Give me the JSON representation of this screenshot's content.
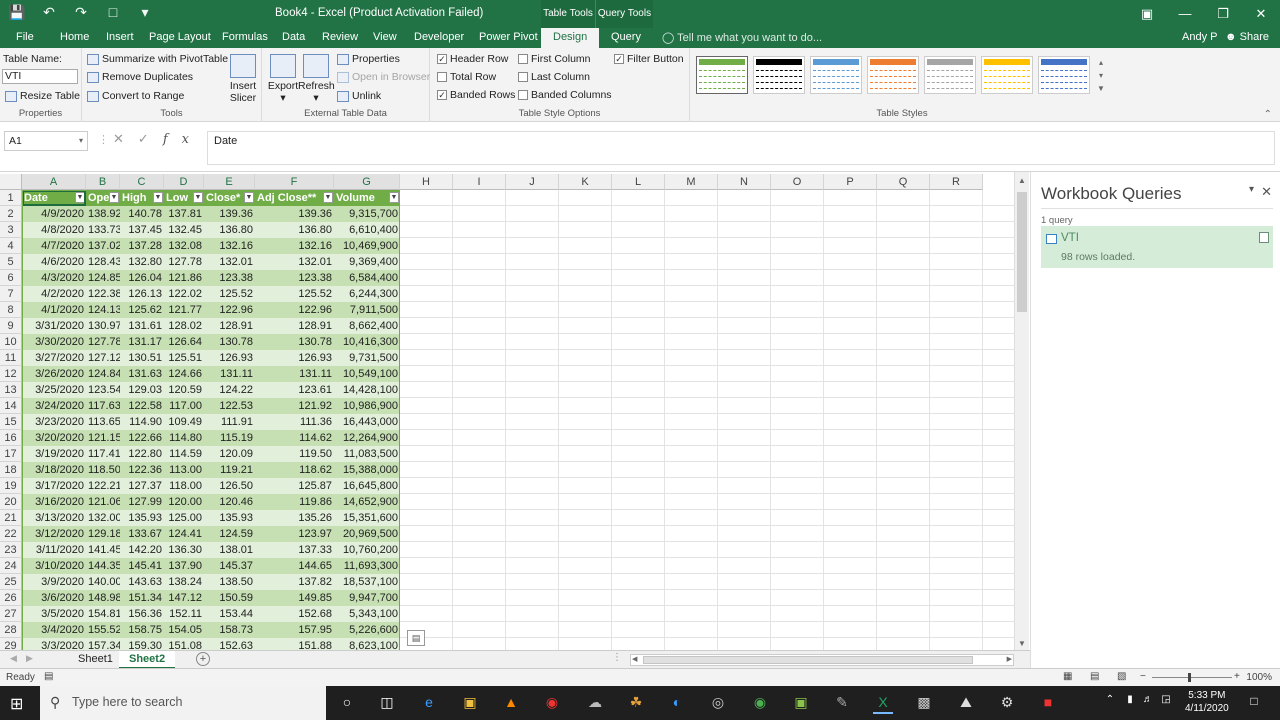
{
  "window": {
    "title": "Book4 - Excel (Product Activation Failed)",
    "context_tabs": [
      "Table Tools",
      "Query Tools"
    ]
  },
  "tabs": {
    "items": [
      "File",
      "Home",
      "Insert",
      "Page Layout",
      "Formulas",
      "Data",
      "Review",
      "View",
      "Developer",
      "Power Pivot",
      "Design",
      "Query"
    ],
    "active": "Design",
    "tell_me": "Tell me what you want to do...",
    "user": "Andy P",
    "share": "Share"
  },
  "ribbon": {
    "properties": {
      "label": "Properties",
      "table_name_label": "Table Name:",
      "table_name_value": "VTI",
      "resize": "Resize Table"
    },
    "tools": {
      "label": "Tools",
      "summarize": "Summarize with PivotTable",
      "remove_dup": "Remove Duplicates",
      "convert": "Convert to Range",
      "insert_slicer_1": "Insert",
      "insert_slicer_2": "Slicer"
    },
    "external": {
      "label": "External Table Data",
      "export": "Export",
      "refresh": "Refresh",
      "properties": "Properties",
      "open_browser": "Open in Browser",
      "unlink": "Unlink"
    },
    "style_options": {
      "label": "Table Style Options",
      "header_row": "Header Row",
      "total_row": "Total Row",
      "banded_rows": "Banded Rows",
      "first_column": "First Column",
      "last_column": "Last Column",
      "banded_columns": "Banded Columns",
      "filter_button": "Filter Button"
    },
    "table_styles": {
      "label": "Table Styles",
      "swatches": [
        "#70ad47",
        "#000000",
        "#5b9bd5",
        "#ed7d31",
        "#a5a5a5",
        "#ffc000",
        "#4472c4"
      ]
    }
  },
  "formula_bar": {
    "name_box": "A1",
    "content": "Date"
  },
  "grid": {
    "columns": [
      "A",
      "B",
      "C",
      "D",
      "E",
      "F",
      "G",
      "H",
      "I",
      "J",
      "K",
      "L",
      "M",
      "N",
      "O",
      "P",
      "Q",
      "R"
    ],
    "table_headers": [
      "Date",
      "Open",
      "High",
      "Low",
      "Close*",
      "Adj Close**",
      "Volume"
    ],
    "rows": [
      [
        "4/9/2020",
        "138.92",
        "140.78",
        "137.81",
        "139.36",
        "139.36",
        "9,315,700"
      ],
      [
        "4/8/2020",
        "133.73",
        "137.45",
        "132.45",
        "136.80",
        "136.80",
        "6,610,400"
      ],
      [
        "4/7/2020",
        "137.02",
        "137.28",
        "132.08",
        "132.16",
        "132.16",
        "10,469,900"
      ],
      [
        "4/6/2020",
        "128.43",
        "132.80",
        "127.78",
        "132.01",
        "132.01",
        "9,369,400"
      ],
      [
        "4/3/2020",
        "124.85",
        "126.04",
        "121.86",
        "123.38",
        "123.38",
        "6,584,400"
      ],
      [
        "4/2/2020",
        "122.38",
        "126.13",
        "122.02",
        "125.52",
        "125.52",
        "6,244,300"
      ],
      [
        "4/1/2020",
        "124.13",
        "125.62",
        "121.77",
        "122.96",
        "122.96",
        "7,911,500"
      ],
      [
        "3/31/2020",
        "130.97",
        "131.61",
        "128.02",
        "128.91",
        "128.91",
        "8,662,400"
      ],
      [
        "3/30/2020",
        "127.78",
        "131.17",
        "126.64",
        "130.78",
        "130.78",
        "10,416,300"
      ],
      [
        "3/27/2020",
        "127.12",
        "130.51",
        "125.51",
        "126.93",
        "126.93",
        "9,731,500"
      ],
      [
        "3/26/2020",
        "124.84",
        "131.63",
        "124.66",
        "131.11",
        "131.11",
        "10,549,100"
      ],
      [
        "3/25/2020",
        "123.54",
        "129.03",
        "120.59",
        "124.22",
        "123.61",
        "14,428,100"
      ],
      [
        "3/24/2020",
        "117.63",
        "122.58",
        "117.00",
        "122.53",
        "121.92",
        "10,986,900"
      ],
      [
        "3/23/2020",
        "113.65",
        "114.90",
        "109.49",
        "111.91",
        "111.36",
        "16,443,000"
      ],
      [
        "3/20/2020",
        "121.15",
        "122.66",
        "114.80",
        "115.19",
        "114.62",
        "12,264,900"
      ],
      [
        "3/19/2020",
        "117.41",
        "122.80",
        "114.59",
        "120.09",
        "119.50",
        "11,083,500"
      ],
      [
        "3/18/2020",
        "118.50",
        "122.36",
        "113.00",
        "119.21",
        "118.62",
        "15,388,000"
      ],
      [
        "3/17/2020",
        "122.21",
        "127.37",
        "118.00",
        "126.50",
        "125.87",
        "16,645,800"
      ],
      [
        "3/16/2020",
        "121.06",
        "127.99",
        "120.00",
        "120.46",
        "119.86",
        "14,652,900"
      ],
      [
        "3/13/2020",
        "132.00",
        "135.93",
        "125.00",
        "135.93",
        "135.26",
        "15,351,600"
      ],
      [
        "3/12/2020",
        "129.18",
        "133.67",
        "124.41",
        "124.59",
        "123.97",
        "20,969,500"
      ],
      [
        "3/11/2020",
        "141.45",
        "142.20",
        "136.30",
        "138.01",
        "137.33",
        "10,760,200"
      ],
      [
        "3/10/2020",
        "144.35",
        "145.41",
        "137.90",
        "145.37",
        "144.65",
        "11,693,300"
      ],
      [
        "3/9/2020",
        "140.00",
        "143.63",
        "138.24",
        "138.50",
        "137.82",
        "18,537,100"
      ],
      [
        "3/6/2020",
        "148.98",
        "151.34",
        "147.12",
        "150.59",
        "149.85",
        "9,947,700"
      ],
      [
        "3/5/2020",
        "154.81",
        "156.36",
        "152.11",
        "153.44",
        "152.68",
        "5,343,100"
      ],
      [
        "3/4/2020",
        "155.52",
        "158.75",
        "154.05",
        "158.73",
        "157.95",
        "5,226,600"
      ],
      [
        "3/3/2020",
        "157.34",
        "159.30",
        "151.08",
        "152.63",
        "151.88",
        "8,623,100"
      ]
    ]
  },
  "sheets": {
    "items": [
      "Sheet1",
      "Sheet2"
    ],
    "active": "Sheet2"
  },
  "status": {
    "ready": "Ready",
    "zoom": "100%"
  },
  "queries": {
    "title": "Workbook Queries",
    "count": "1 query",
    "item_name": "VTI",
    "item_status": "98 rows loaded."
  },
  "taskbar": {
    "search_placeholder": "Type here to search",
    "time": "5:33 PM",
    "date": "4/11/2020"
  }
}
